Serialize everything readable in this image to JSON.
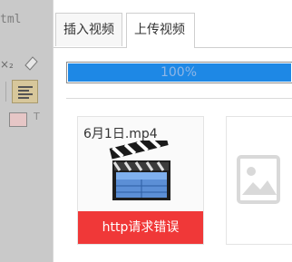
{
  "background": {
    "code_label": "tml",
    "subscript_label": "×₂",
    "t_label": "T"
  },
  "tabs": [
    {
      "label": "插入视频"
    },
    {
      "label": "上传视频"
    }
  ],
  "upload": {
    "progress_text": "100%",
    "progress_value": 1.0
  },
  "files": [
    {
      "name": "6月1日.mp4",
      "status": "http请求错误"
    }
  ],
  "colors": {
    "progress_fill": "#1e88e5",
    "error_bg": "#f03838"
  }
}
